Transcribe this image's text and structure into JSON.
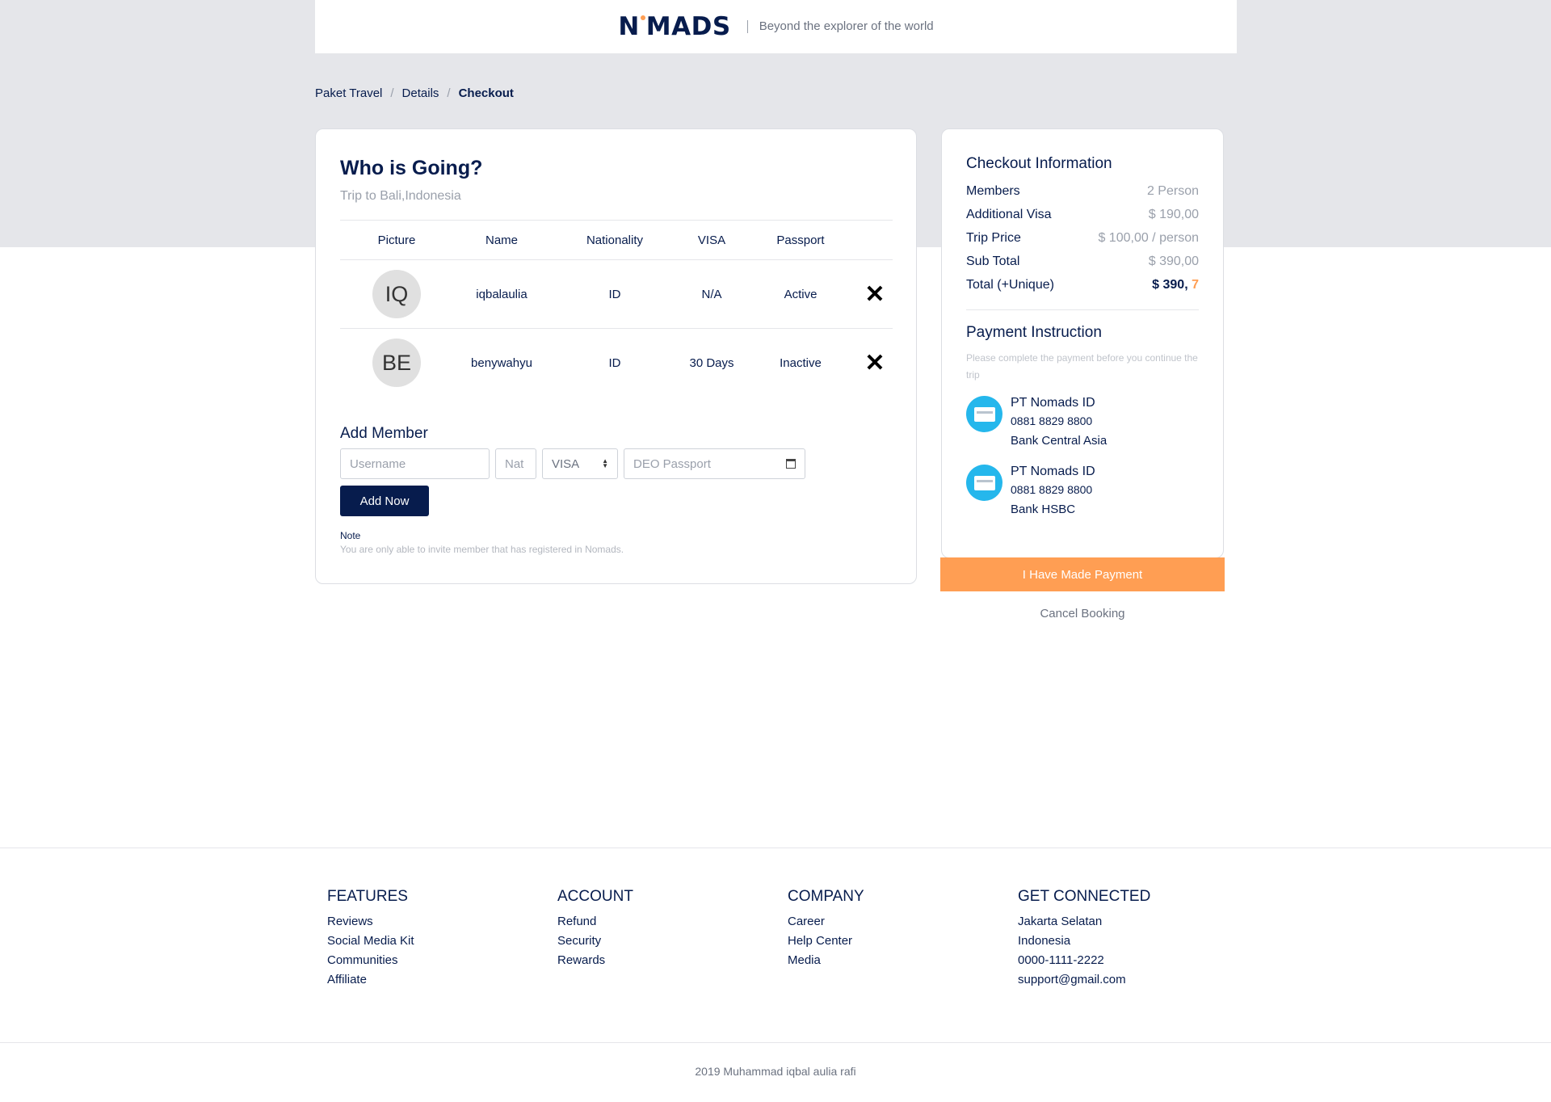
{
  "brand": {
    "logo_left": "N",
    "logo_right": "MADS",
    "tagline": "Beyond the explorer of the world",
    "accent": "#ff9e53",
    "primary": "#071c4d"
  },
  "breadcrumb": [
    "Paket Travel",
    "Details",
    "Checkout"
  ],
  "who": {
    "title": "Who is Going?",
    "subtitle": "Trip to Bali,Indonesia",
    "columns": [
      "Picture",
      "Name",
      "Nationality",
      "VISA",
      "Passport"
    ],
    "members": [
      {
        "initials": "IQ",
        "name": "iqbalaulia",
        "nationality": "ID",
        "visa": "N/A",
        "passport": "Active",
        "remove_icon": "close-icon"
      },
      {
        "initials": "BE",
        "name": "benywahyu",
        "nationality": "ID",
        "visa": "30 Days",
        "passport": "Inactive",
        "remove_icon": "close-icon"
      }
    ]
  },
  "add_member": {
    "title": "Add Member",
    "username_placeholder": "Username",
    "nationality_placeholder": "Nat",
    "visa_value": "VISA",
    "passport_placeholder": "DEO Passport",
    "button": "Add Now",
    "note_label": "Note",
    "note_text": "You are only able to invite member that has registered in Nomads."
  },
  "checkout": {
    "title": "Checkout Information",
    "rows": [
      {
        "label": "Members",
        "value": "2 Person"
      },
      {
        "label": "Additional Visa",
        "value": "$ 190,00"
      },
      {
        "label": "Trip Price",
        "value": "$ 100,00 / person"
      },
      {
        "label": "Sub Total",
        "value": "$ 390,00"
      }
    ],
    "total_label": "Total (+Unique)",
    "total_value": "$ 390,",
    "total_unique": "7"
  },
  "payment": {
    "title": "Payment Instruction",
    "text": "Please complete the payment before you continue the trip",
    "banks": [
      {
        "name": "PT Nomads ID",
        "number": "0881 8829 8800",
        "bank": "Bank Central Asia"
      },
      {
        "name": "PT Nomads ID",
        "number": "0881 8829 8800",
        "bank": "Bank HSBC"
      }
    ],
    "paid_button": "I Have Made Payment",
    "cancel": "Cancel Booking"
  },
  "footer": {
    "columns": [
      {
        "title": "FEATURES",
        "items": [
          "Reviews",
          "Social Media Kit",
          "Communities",
          "Affiliate"
        ]
      },
      {
        "title": "ACCOUNT",
        "items": [
          "Refund",
          "Security",
          "Rewards"
        ]
      },
      {
        "title": "COMPANY",
        "items": [
          "Career",
          "Help Center",
          "Media"
        ]
      },
      {
        "title": "GET CONNECTED",
        "items": [
          "Jakarta Selatan",
          "Indonesia",
          "0000-1111-2222",
          "support@gmail.com"
        ]
      }
    ],
    "copyright": "2019 Muhammad iqbal aulia rafi"
  }
}
